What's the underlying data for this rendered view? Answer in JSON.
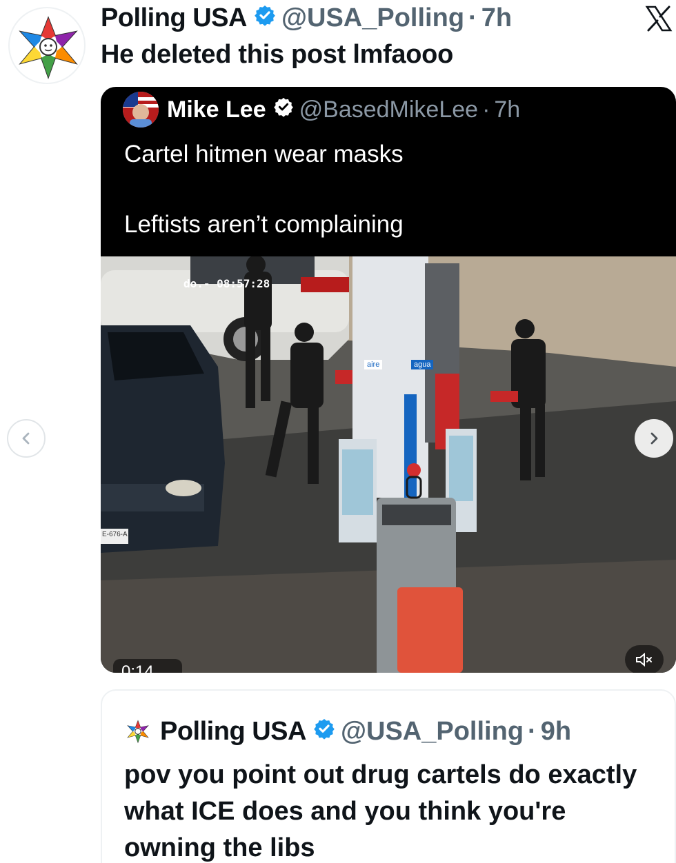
{
  "tweet": {
    "author_name": "Polling USA",
    "handle": "@USA_Polling",
    "separator": "·",
    "time": "7h",
    "text": "He deleted this post lmfaooo"
  },
  "quoted_post": {
    "author_name": "Mike Lee",
    "handle": "@BasedMikeLee",
    "separator": "·",
    "time": "7h",
    "line1": "Cartel hitmen wear masks",
    "line2": "Leftists aren’t complaining"
  },
  "video": {
    "timestamp_overlay": "do.- 08:57:28",
    "duration": "0:14",
    "pump_label_1": "aire",
    "pump_label_2": "agua",
    "plate_text": "E-676-A"
  },
  "nested_quote": {
    "author_name": "Polling USA",
    "handle": "@USA_Polling",
    "separator": "·",
    "time": "9h",
    "text": "pov you point out drug cartels do exactly what ICE does and you think you're owning the libs"
  },
  "colors": {
    "verified_blue": "#1d9bf0",
    "secondary_text": "#536471",
    "quote_background": "#000000"
  },
  "icons": {
    "platform": "x-logo-icon",
    "verified": "verified-badge-icon",
    "carousel_prev": "chevron-left-icon",
    "carousel_next": "chevron-right-icon",
    "mute": "speaker-muted-icon"
  }
}
